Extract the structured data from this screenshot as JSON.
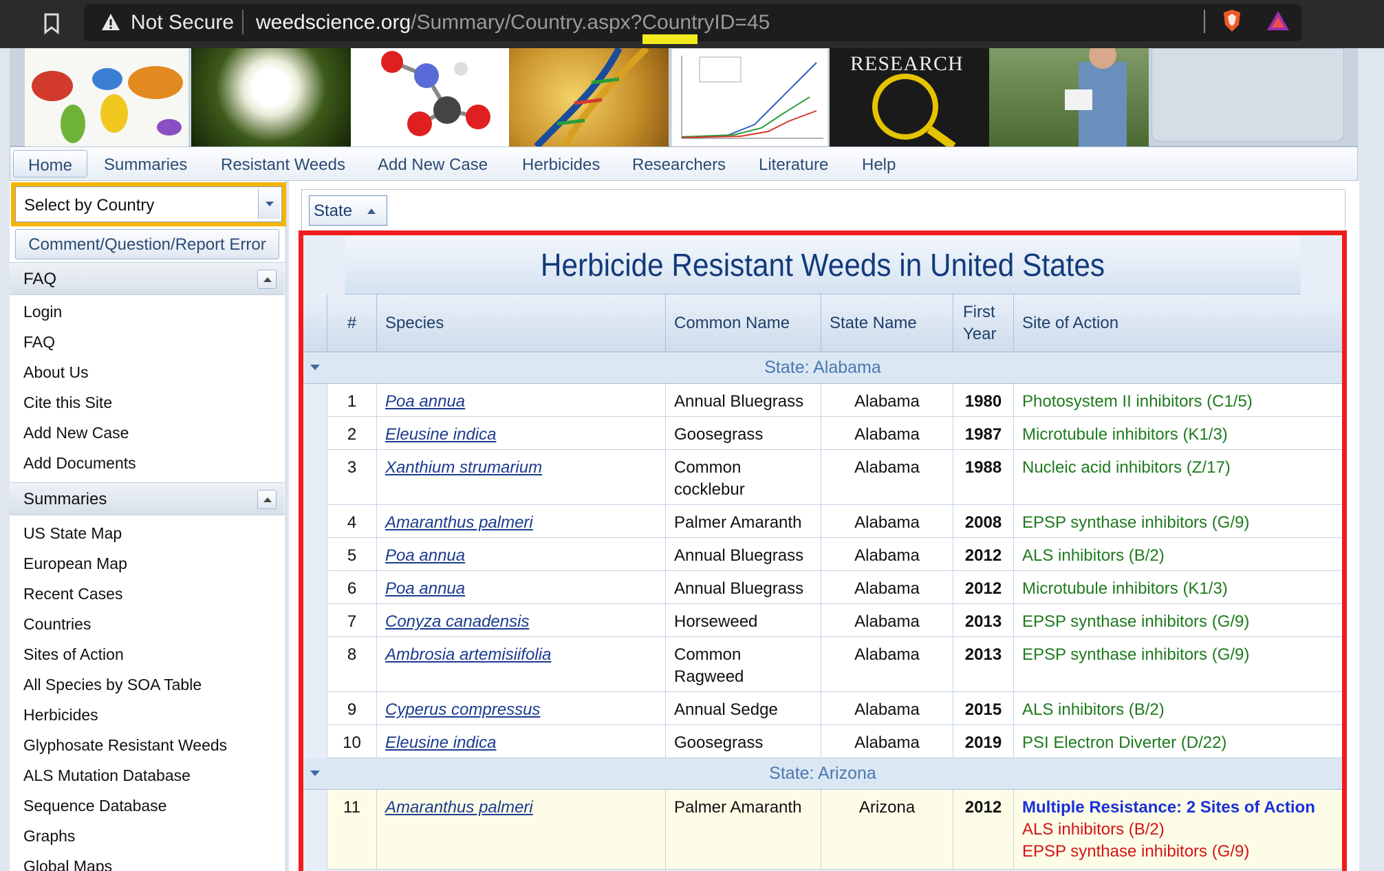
{
  "browser": {
    "security_label": "Not Secure",
    "url_domain": "weedscience.org",
    "url_path": "/Summary/Country.aspx?CountryID=45"
  },
  "banner": {
    "research_text": "RESEARCH"
  },
  "nav": {
    "items": [
      "Home",
      "Summaries",
      "Resistant Weeds",
      "Add New Case",
      "Herbicides",
      "Researchers",
      "Literature",
      "Help"
    ]
  },
  "sidebar": {
    "country_select": "Select by Country",
    "comment_button": "Comment/Question/Report Error",
    "faq_header": "FAQ",
    "faq_links": [
      "Login",
      "FAQ",
      "About Us",
      "Cite this Site",
      "Add New Case",
      "Add Documents"
    ],
    "summaries_header": "Summaries",
    "summary_links": [
      "US State Map",
      "European Map",
      "Recent Cases",
      "Countries",
      "Sites of Action",
      "All Species by SOA Table",
      "Herbicides",
      "Glyphosate Resistant Weeds",
      "ALS Mutation Database",
      "Sequence Database",
      "Graphs",
      "Global Maps"
    ]
  },
  "grid": {
    "group_chip": "State",
    "title": "Herbicide Resistant Weeds in United States",
    "columns": {
      "num": "#",
      "species": "Species",
      "common": "Common Name",
      "state": "State Name",
      "first_year": "First Year",
      "soa": "Site of Action"
    },
    "groups": [
      {
        "label": "State: Alabama"
      },
      {
        "label": "State: Arizona"
      }
    ],
    "rows": [
      {
        "num": "1",
        "species": "Poa annua",
        "common": "Annual Bluegrass",
        "state": "Alabama",
        "year": "1980",
        "soa": "Photosystem II inhibitors (C1/5)"
      },
      {
        "num": "2",
        "species": "Eleusine indica",
        "common": "Goosegrass",
        "state": "Alabama",
        "year": "1987",
        "soa": "Microtubule inhibitors (K1/3)"
      },
      {
        "num": "3",
        "species": "Xanthium strumarium",
        "common": "Common cocklebur",
        "state": "Alabama",
        "year": "1988",
        "soa": "Nucleic acid inhibitors (Z/17)"
      },
      {
        "num": "4",
        "species": "Amaranthus palmeri",
        "common": "Palmer Amaranth",
        "state": "Alabama",
        "year": "2008",
        "soa": "EPSP synthase inhibitors (G/9)"
      },
      {
        "num": "5",
        "species": "Poa annua",
        "common": "Annual Bluegrass",
        "state": "Alabama",
        "year": "2012",
        "soa": "ALS inhibitors (B/2)"
      },
      {
        "num": "6",
        "species": "Poa annua",
        "common": "Annual Bluegrass",
        "state": "Alabama",
        "year": "2012",
        "soa": "Microtubule inhibitors (K1/3)"
      },
      {
        "num": "7",
        "species": "Conyza canadensis",
        "common": "Horseweed",
        "state": "Alabama",
        "year": "2013",
        "soa": "EPSP synthase inhibitors (G/9)"
      },
      {
        "num": "8",
        "species": "Ambrosia artemisiifolia",
        "common": "Common Ragweed",
        "state": "Alabama",
        "year": "2013",
        "soa": "EPSP synthase inhibitors (G/9)"
      },
      {
        "num": "9",
        "species": "Cyperus compressus",
        "common": "Annual Sedge",
        "state": "Alabama",
        "year": "2015",
        "soa": "ALS inhibitors (B/2)"
      },
      {
        "num": "10",
        "species": "Eleusine indica",
        "common": "Goosegrass",
        "state": "Alabama",
        "year": "2019",
        "soa": "PSI Electron Diverter (D/22)"
      },
      {
        "num": "11",
        "species": "Amaranthus palmeri",
        "common": "Palmer Amaranth",
        "state": "Arizona",
        "year": "2012",
        "soa_multi": "Multiple Resistance: 2 Sites of Action",
        "soa_1": "ALS inhibitors (B/2)",
        "soa_2": "EPSP synthase inhibitors (G/9)"
      }
    ]
  }
}
